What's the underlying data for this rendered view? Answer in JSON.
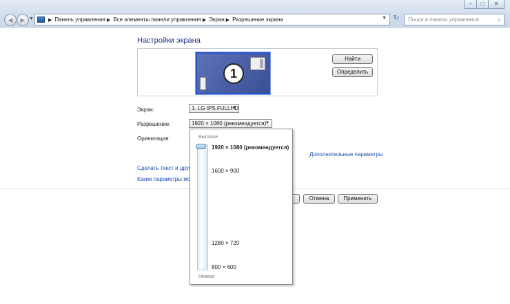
{
  "window": {
    "minimize": "–",
    "maximize": "□",
    "close": "✕",
    "close_color": "#c9473a"
  },
  "nav": {
    "back": "◀",
    "forward": "▶",
    "history": "▼"
  },
  "address": {
    "icon": "control-panel-icon",
    "breadcrumbs": [
      "Панель управления",
      "Все элементы панели управления",
      "Экран",
      "Разрешение экрана"
    ],
    "dropdown": "▼",
    "refresh": "↻"
  },
  "search": {
    "placeholder": "Поиск в панели управления",
    "icon": "⌕"
  },
  "page": {
    "title": "Настройки экрана"
  },
  "preview": {
    "monitor_number": "1",
    "find_button": "Найти",
    "identify_button": "Определить"
  },
  "form": {
    "screen_label": "Экран:",
    "screen_value": "1. LG IPS FULLHD",
    "resolution_label": "Разрешение:",
    "resolution_value": "1920 × 1080 (рекомендуется)",
    "orientation_label": "Ориентация:",
    "arrow": "▼"
  },
  "links": {
    "advanced": "Дополнительные параметры",
    "text_size": "Сделать текст и други",
    "monitor_params": "Какие параметры мон"
  },
  "buttons": {
    "cancel": "Отмена",
    "apply": "Применить"
  },
  "resolution_popup": {
    "high_label": "Высокое",
    "low_label": "Низкое",
    "options": [
      {
        "label": "1920 × 1080 (рекомендуется)",
        "selected": true
      },
      {
        "label": "1600 × 900",
        "selected": false
      },
      {
        "label": "1280 × 720",
        "selected": false
      },
      {
        "label": "800 × 600",
        "selected": false
      }
    ],
    "slider_value": "1920 × 1080 (рекомендуется)"
  },
  "colors": {
    "title_blue": "#1e3287",
    "link_blue": "#1e4fb0",
    "monitor_fill": "#4a5fa6",
    "monitor_selected_border": "#2a54c9"
  }
}
